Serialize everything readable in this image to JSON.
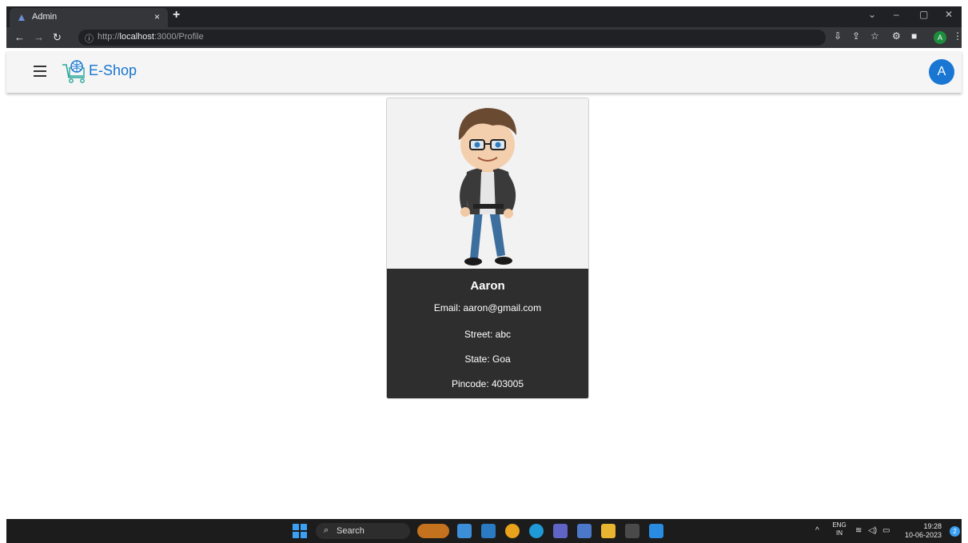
{
  "browser": {
    "tab_title": "Admin",
    "tab_close": "×",
    "new_tab": "+",
    "url_prefix": "http://",
    "url_host": "localhost",
    "url_path": ":3000/Profile",
    "window_controls": [
      "⌄",
      "–",
      "▢",
      "✕"
    ],
    "nav_icons": [
      "back-icon",
      "forward-icon",
      "reload-icon"
    ],
    "toolbar_icons": [
      "install-icon",
      "share-icon",
      "bookmark-star-icon",
      "extensions-icon",
      "sidepanel-icon",
      "menu-dots-icon"
    ],
    "profile_initial": "A"
  },
  "app": {
    "brand": "E-Shop",
    "avatar_initial": "A",
    "colors": {
      "primary": "#1976d2",
      "card_body": "#2e2e2e",
      "header_bg": "#f5f5f5"
    }
  },
  "profile": {
    "name": "Aaron",
    "email": "Email: aaron@gmail.com",
    "street": "Street: abc",
    "state": "State: Goa",
    "pincode": "Pincode: 403005"
  },
  "taskbar": {
    "search_label": "Search",
    "apps": [
      "widgets-icon",
      "store-icon",
      "app-icon",
      "chrome-icon",
      "edge-icon",
      "teams-icon",
      "vs-icon",
      "explorer-icon",
      "terminal-icon",
      "vscode-icon"
    ],
    "lang_top": "ENG",
    "lang_bottom": "IN",
    "time": "19:28",
    "date": "10-06-2023",
    "notifications": "2"
  }
}
